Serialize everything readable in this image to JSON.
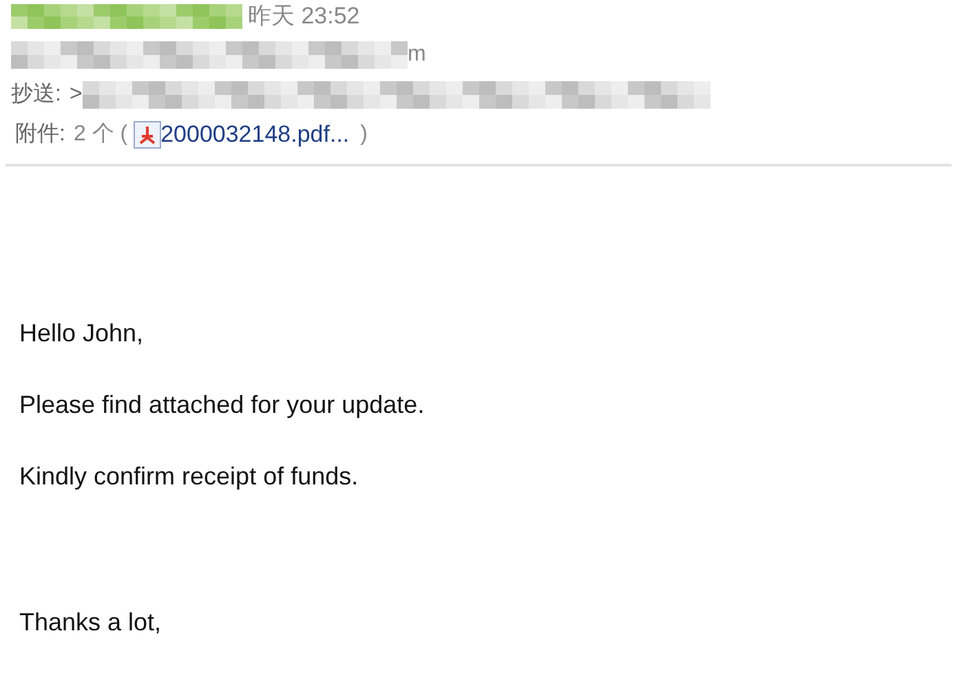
{
  "header": {
    "time": "昨天 23:52",
    "from_suffix": "m",
    "cc_label": "抄送:",
    "cc_prefix": ">",
    "attachments": {
      "label": "附件:",
      "count": "2 个 (",
      "file": "2000032148.pdf...",
      "close": ")"
    }
  },
  "body": [
    "Hello John,",
    "Please find attached for your update.",
    "Kindly confirm receipt of funds.",
    "Thanks a lot,"
  ]
}
